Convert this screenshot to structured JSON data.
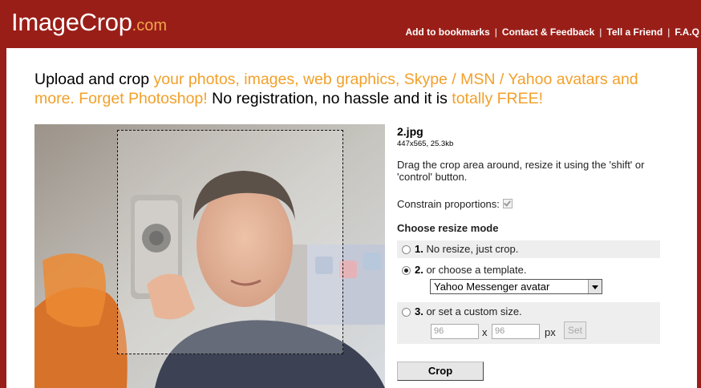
{
  "header": {
    "logo_main": "ImageCrop",
    "logo_domain": ".com",
    "nav": [
      "Add to bookmarks",
      "Contact & Feedback",
      "Tell a Friend",
      "F.A.Q"
    ],
    "nav_separator": "|"
  },
  "headline": {
    "part1": "Upload and crop ",
    "part2": "your photos, images, web graphics, Skype / MSN / Yahoo avatars and more. Forget Photoshop!",
    "part3": " No registration, no hassle and it is ",
    "part4": "totally FREE!"
  },
  "image": {
    "icon": "uploaded-photo"
  },
  "file": {
    "name": "2.jpg",
    "info": "447x565, 25.3kb"
  },
  "instructions": "Drag the crop area around, resize it using the 'shift' or 'control' button.",
  "constrain": {
    "label": "Constrain proportions:",
    "checked": true
  },
  "resize": {
    "heading": "Choose resize mode",
    "options": [
      {
        "num": "1.",
        "label": " No resize, just crop.",
        "selected": false
      },
      {
        "num": "2.",
        "label": " or choose a template.",
        "selected": true
      },
      {
        "num": "3.",
        "label": " or set a custom size.",
        "selected": false
      }
    ],
    "template_value": "Yahoo Messenger avatar",
    "width_value": "96",
    "height_value": "96",
    "x_label": "x",
    "px_label": "px",
    "set_label": "Set"
  },
  "crop_label": "Crop",
  "colors": {
    "header_bg": "#9a1e18",
    "accent_orange": "#f2a02a"
  }
}
